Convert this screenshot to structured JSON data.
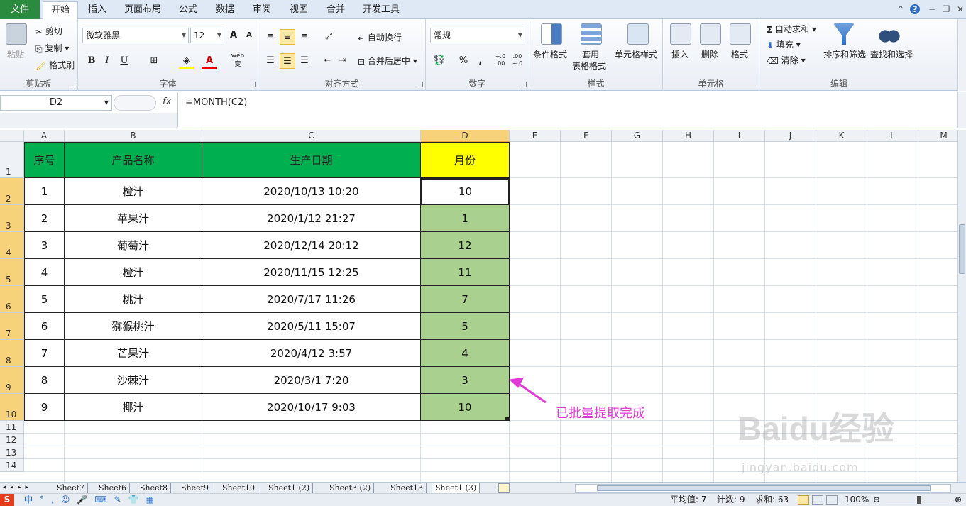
{
  "ribbon_tabs": [
    "文件",
    "开始",
    "插入",
    "页面布局",
    "公式",
    "数据",
    "审阅",
    "视图",
    "合并",
    "开发工具"
  ],
  "clipboard": {
    "paste": "粘贴",
    "cut": "剪切",
    "copy": "复制",
    "painter": "格式刷",
    "label": "剪贴板"
  },
  "font": {
    "name": "微软雅黑",
    "size": "12",
    "label": "字体",
    "bold": "B",
    "italic": "I",
    "underline": "U",
    "grow": "A",
    "shrink": "A",
    "wen": "wén",
    "wenc": "变"
  },
  "align": {
    "wrap": "自动换行",
    "merge": "合并后居中",
    "label": "对齐方式"
  },
  "number": {
    "format": "常规",
    "label": "数字",
    "pct": "%",
    "comma": ",",
    "inc": "+.0 .00",
    "dec": ".00 +.0"
  },
  "styles": {
    "cond": "条件格式",
    "table1": "套用",
    "table2": "表格格式",
    "cell": "单元格样式",
    "label": "样式"
  },
  "cells": {
    "insert": "插入",
    "delete": "删除",
    "format": "格式",
    "label": "单元格"
  },
  "editing": {
    "autosum": "自动求和",
    "fill": "填充",
    "clear": "清除",
    "sort": "排序和筛选",
    "find": "查找和选择",
    "label": "编辑"
  },
  "formula_bar": {
    "name_box": "D2",
    "fx": "fx",
    "formula": "=MONTH(C2)"
  },
  "columns": [
    "A",
    "B",
    "C",
    "D",
    "E",
    "F",
    "G",
    "H",
    "I",
    "J",
    "K",
    "L",
    "M"
  ],
  "rows": [
    "1",
    "2",
    "3",
    "4",
    "5",
    "6",
    "7",
    "8",
    "9",
    "10",
    "11",
    "12",
    "13",
    "14"
  ],
  "table": {
    "headers": [
      "序号",
      "产品名称",
      "生产日期",
      "月份"
    ],
    "rows": [
      [
        "1",
        "橙汁",
        "2020/10/13 10:20",
        "10"
      ],
      [
        "2",
        "苹果汁",
        "2020/1/12 21:27",
        "1"
      ],
      [
        "3",
        "葡萄汁",
        "2020/12/14 20:12",
        "12"
      ],
      [
        "4",
        "橙汁",
        "2020/11/15 12:25",
        "11"
      ],
      [
        "5",
        "桃汁",
        "2020/7/17 11:26",
        "7"
      ],
      [
        "6",
        "猕猴桃汁",
        "2020/5/11 15:07",
        "5"
      ],
      [
        "7",
        "芒果汁",
        "2020/4/12 3:57",
        "4"
      ],
      [
        "8",
        "沙棘汁",
        "2020/3/1 7:20",
        "3"
      ],
      [
        "9",
        "椰汁",
        "2020/10/17 9:03",
        "10"
      ]
    ]
  },
  "annotation": "已批量提取完成",
  "watermark": {
    "logo": "Baidu经验",
    "url": "jingyan.baidu.com"
  },
  "sheet_tabs": [
    "Sheet7",
    "Sheet6",
    "Sheet8",
    "Sheet9",
    "Sheet10",
    "Sheet1 (2)",
    "Sheet3 (2)",
    "Sheet13",
    "Sheet1 (3)"
  ],
  "status": {
    "average": "平均值: 7",
    "count": "计数: 9",
    "sum": "求和: 63",
    "zoom": "100%"
  },
  "ime": {
    "lang": "中"
  }
}
